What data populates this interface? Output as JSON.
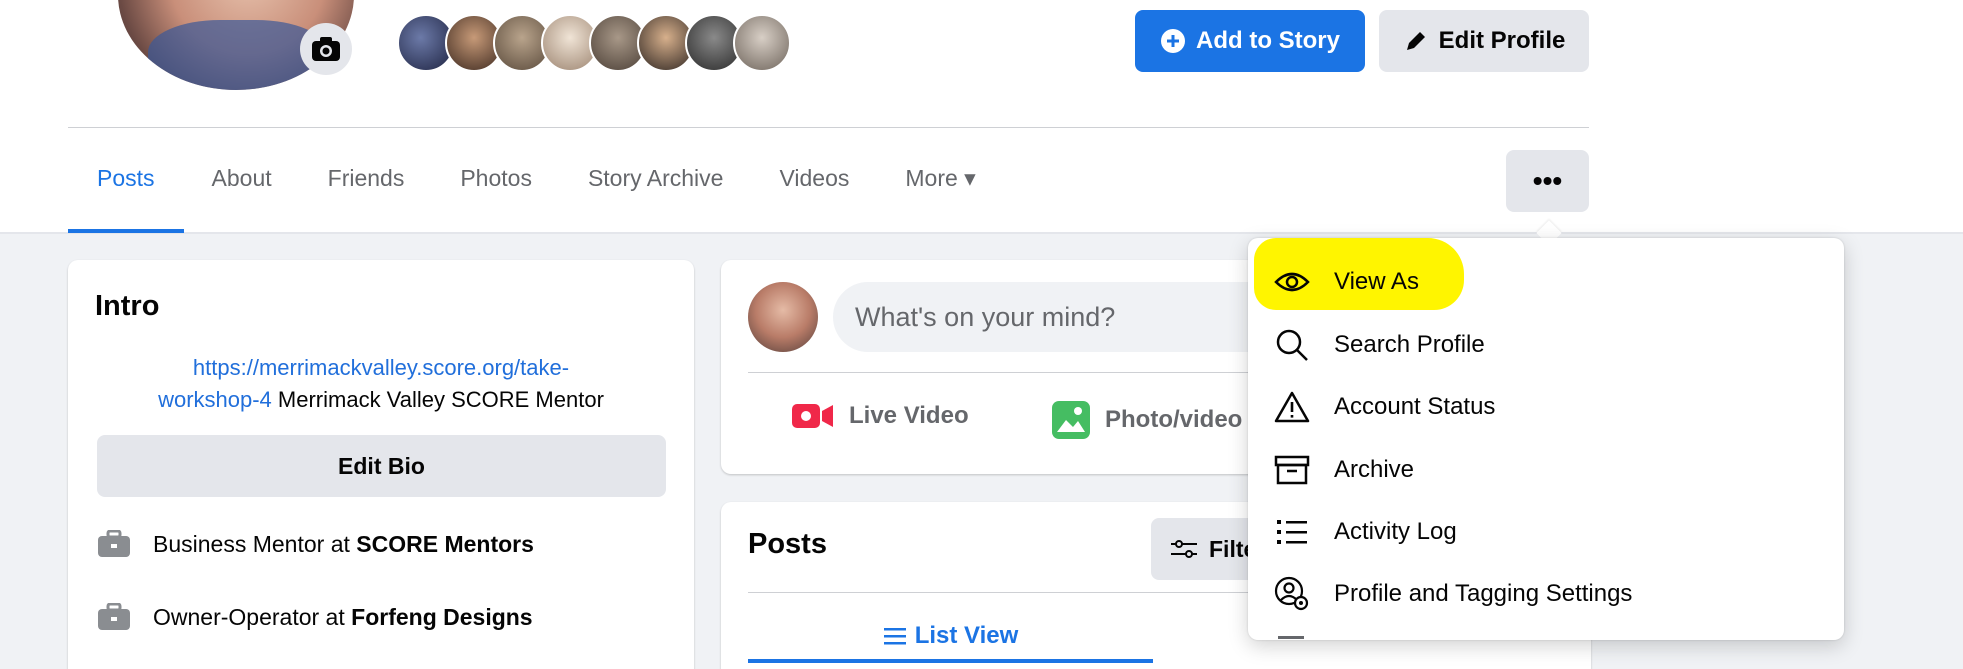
{
  "profile": {
    "camera_icon": "camera-icon",
    "friend_avatar_colors": [
      "#2b2d42",
      "#5a4636",
      "#7d6a55",
      "#c9b8a6",
      "#8a7b6e",
      "#6f5b4b",
      "#3c3c3c",
      "#9b8f85"
    ]
  },
  "actions": {
    "add_story": "Add to Story",
    "edit_profile": "Edit Profile",
    "primary_color": "#1b74e4"
  },
  "tabs": [
    {
      "label": "Posts"
    },
    {
      "label": "About"
    },
    {
      "label": "Friends"
    },
    {
      "label": "Photos"
    },
    {
      "label": "Story Archive"
    },
    {
      "label": "Videos"
    },
    {
      "label": "More ▾"
    }
  ],
  "more_button": "•••",
  "intro": {
    "title": "Intro",
    "bio_link_1": "https://merrimackvalley.score.org/take-",
    "bio_link_2": "workshop-4",
    "bio_text": " Merrimack Valley SCORE Mentor",
    "edit_bio": "Edit Bio",
    "work": [
      {
        "role": "Business Mentor at ",
        "org": "SCORE Mentors"
      },
      {
        "role": "Owner-Operator at ",
        "org": "Forfeng Designs"
      }
    ]
  },
  "composer": {
    "placeholder": "What's on your mind?",
    "live_video": "Live Video",
    "photo_video": "Photo/video"
  },
  "posts": {
    "title": "Posts",
    "filters": "Filters",
    "list_view": "List View"
  },
  "menu": {
    "items": [
      {
        "label": "View As",
        "icon": "eye-icon"
      },
      {
        "label": "Search Profile",
        "icon": "search-icon"
      },
      {
        "label": "Account Status",
        "icon": "warning-icon"
      },
      {
        "label": "Archive",
        "icon": "archive-icon"
      },
      {
        "label": "Activity Log",
        "icon": "list-icon"
      },
      {
        "label": "Profile and Tagging Settings",
        "icon": "profile-settings-icon"
      }
    ],
    "highlight_color": "#fff500"
  }
}
